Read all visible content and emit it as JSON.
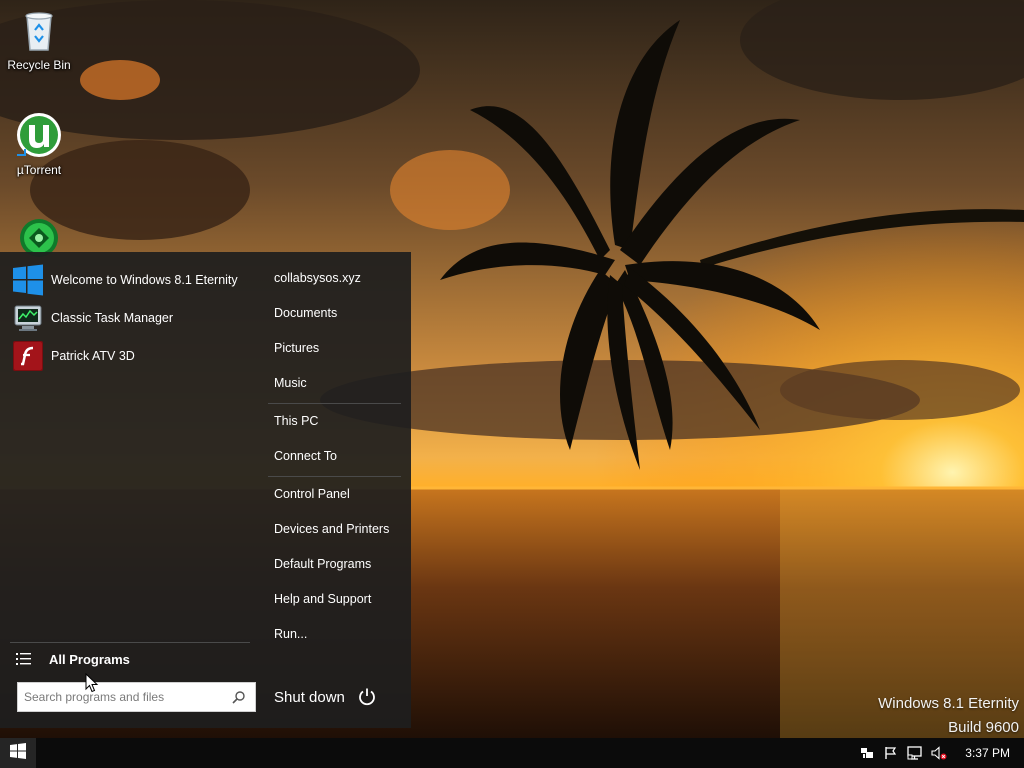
{
  "desktop": {
    "icons": [
      {
        "label": "Recycle Bin",
        "icon": "recycle-bin-icon"
      },
      {
        "label": "µTorrent",
        "icon": "utorrent-icon"
      },
      {
        "label": "",
        "icon": "green-globe-icon"
      }
    ],
    "watermark": {
      "line1": "Windows 8.1 Eternity",
      "line2": "Build 9600"
    }
  },
  "start_menu": {
    "programs": [
      {
        "label": "Welcome to Windows 8.1 Eternity",
        "icon": "windows-logo-icon"
      },
      {
        "label": "Classic Task Manager",
        "icon": "task-manager-icon"
      },
      {
        "label": "Patrick ATV 3D",
        "icon": "flash-icon"
      }
    ],
    "all_programs_label": "All Programs",
    "search": {
      "placeholder": "Search programs and files",
      "value": ""
    },
    "places_group1": [
      "collabsysos.xyz",
      "Documents",
      "Pictures",
      "Music"
    ],
    "places_group2": [
      "This PC",
      "Connect To"
    ],
    "places_group3": [
      "Control Panel",
      "Devices and Printers",
      "Default Programs",
      "Help and Support",
      "Run..."
    ],
    "shutdown_label": "Shut down"
  },
  "taskbar": {
    "clock": "3:37 PM",
    "tray_icons": [
      "action-center-icon",
      "flag-icon",
      "network-icon",
      "volume-muted-icon"
    ]
  },
  "colors": {
    "start_menu_bg": "#1e1e1e",
    "taskbar_bg": "#0b0b0b",
    "windows_blue": "#1e90e8"
  }
}
